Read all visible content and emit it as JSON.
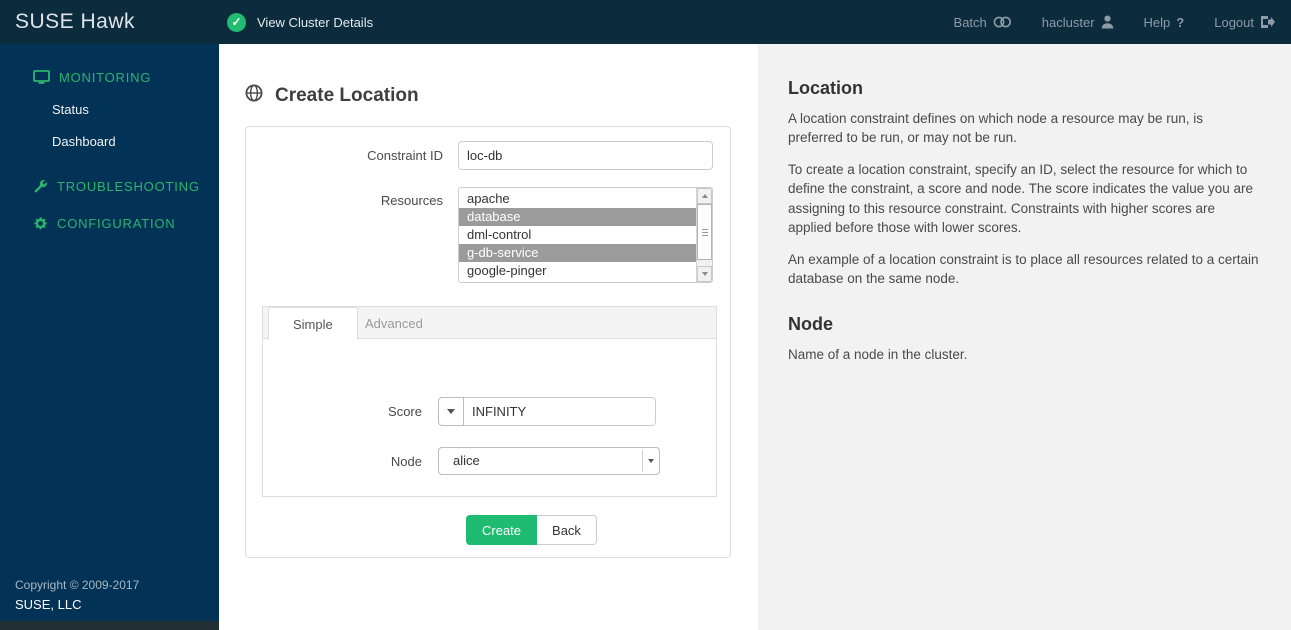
{
  "colors": {
    "topbar_bg": "#0c2b3c",
    "sidebar_bg": "#023256",
    "nav_green": "#2db36e",
    "accent_green": "#1fbc72",
    "selected_option_bg": "#9b9b9b",
    "help_bg": "#f2f2f2"
  },
  "topbar": {
    "brand": "SUSE Hawk",
    "status_icon": "check-circle-icon",
    "status_label": "View Cluster Details",
    "links": [
      {
        "label": "Batch",
        "icon": "toggle-icon"
      },
      {
        "label": "hacluster",
        "icon": "user-icon"
      },
      {
        "label": "Help",
        "icon": "question-icon",
        "icon_glyph": "?"
      },
      {
        "label": "Logout",
        "icon": "logout-icon"
      }
    ]
  },
  "sidebar": {
    "sections": [
      {
        "label": "MONITORING",
        "icon": "monitor-icon",
        "items": [
          {
            "label": "Status"
          },
          {
            "label": "Dashboard"
          }
        ]
      },
      {
        "label": "TROUBLESHOOTING",
        "icon": "wrench-icon",
        "items": []
      },
      {
        "label": "CONFIGURATION",
        "icon": "gear-icon",
        "items": []
      }
    ],
    "copyright_line1": "Copyright © 2009-2017",
    "copyright_line2": "SUSE, LLC"
  },
  "form": {
    "title": "Create Location",
    "title_icon": "globe-icon",
    "constraint_id_label": "Constraint ID",
    "constraint_id_value": "loc-db",
    "resources_label": "Resources",
    "resources": [
      {
        "name": "apache",
        "selected": false
      },
      {
        "name": "database",
        "selected": true
      },
      {
        "name": "dml-control",
        "selected": false
      },
      {
        "name": "g-db-service",
        "selected": true
      },
      {
        "name": "google-pinger",
        "selected": false
      }
    ],
    "tabs": [
      {
        "label": "Simple",
        "active": true
      },
      {
        "label": "Advanced",
        "active": false
      }
    ],
    "score_label": "Score",
    "score_value": "INFINITY",
    "node_label": "Node",
    "node_value": "alice",
    "create_label": "Create",
    "back_label": "Back"
  },
  "help": {
    "sections": [
      {
        "title": "Location",
        "paragraphs": [
          "A location constraint defines on which node a resource may be run, is preferred to be run, or may not be run.",
          "To create a location constraint, specify an ID, select the resource for which to define the constraint, a score and node. The score indicates the value you are assigning to this resource constraint. Constraints with higher scores are applied before those with lower scores.",
          "An example of a location constraint is to place all resources related to a certain database on the same node."
        ]
      },
      {
        "title": "Node",
        "paragraphs": [
          "Name of a node in the cluster."
        ]
      }
    ]
  }
}
